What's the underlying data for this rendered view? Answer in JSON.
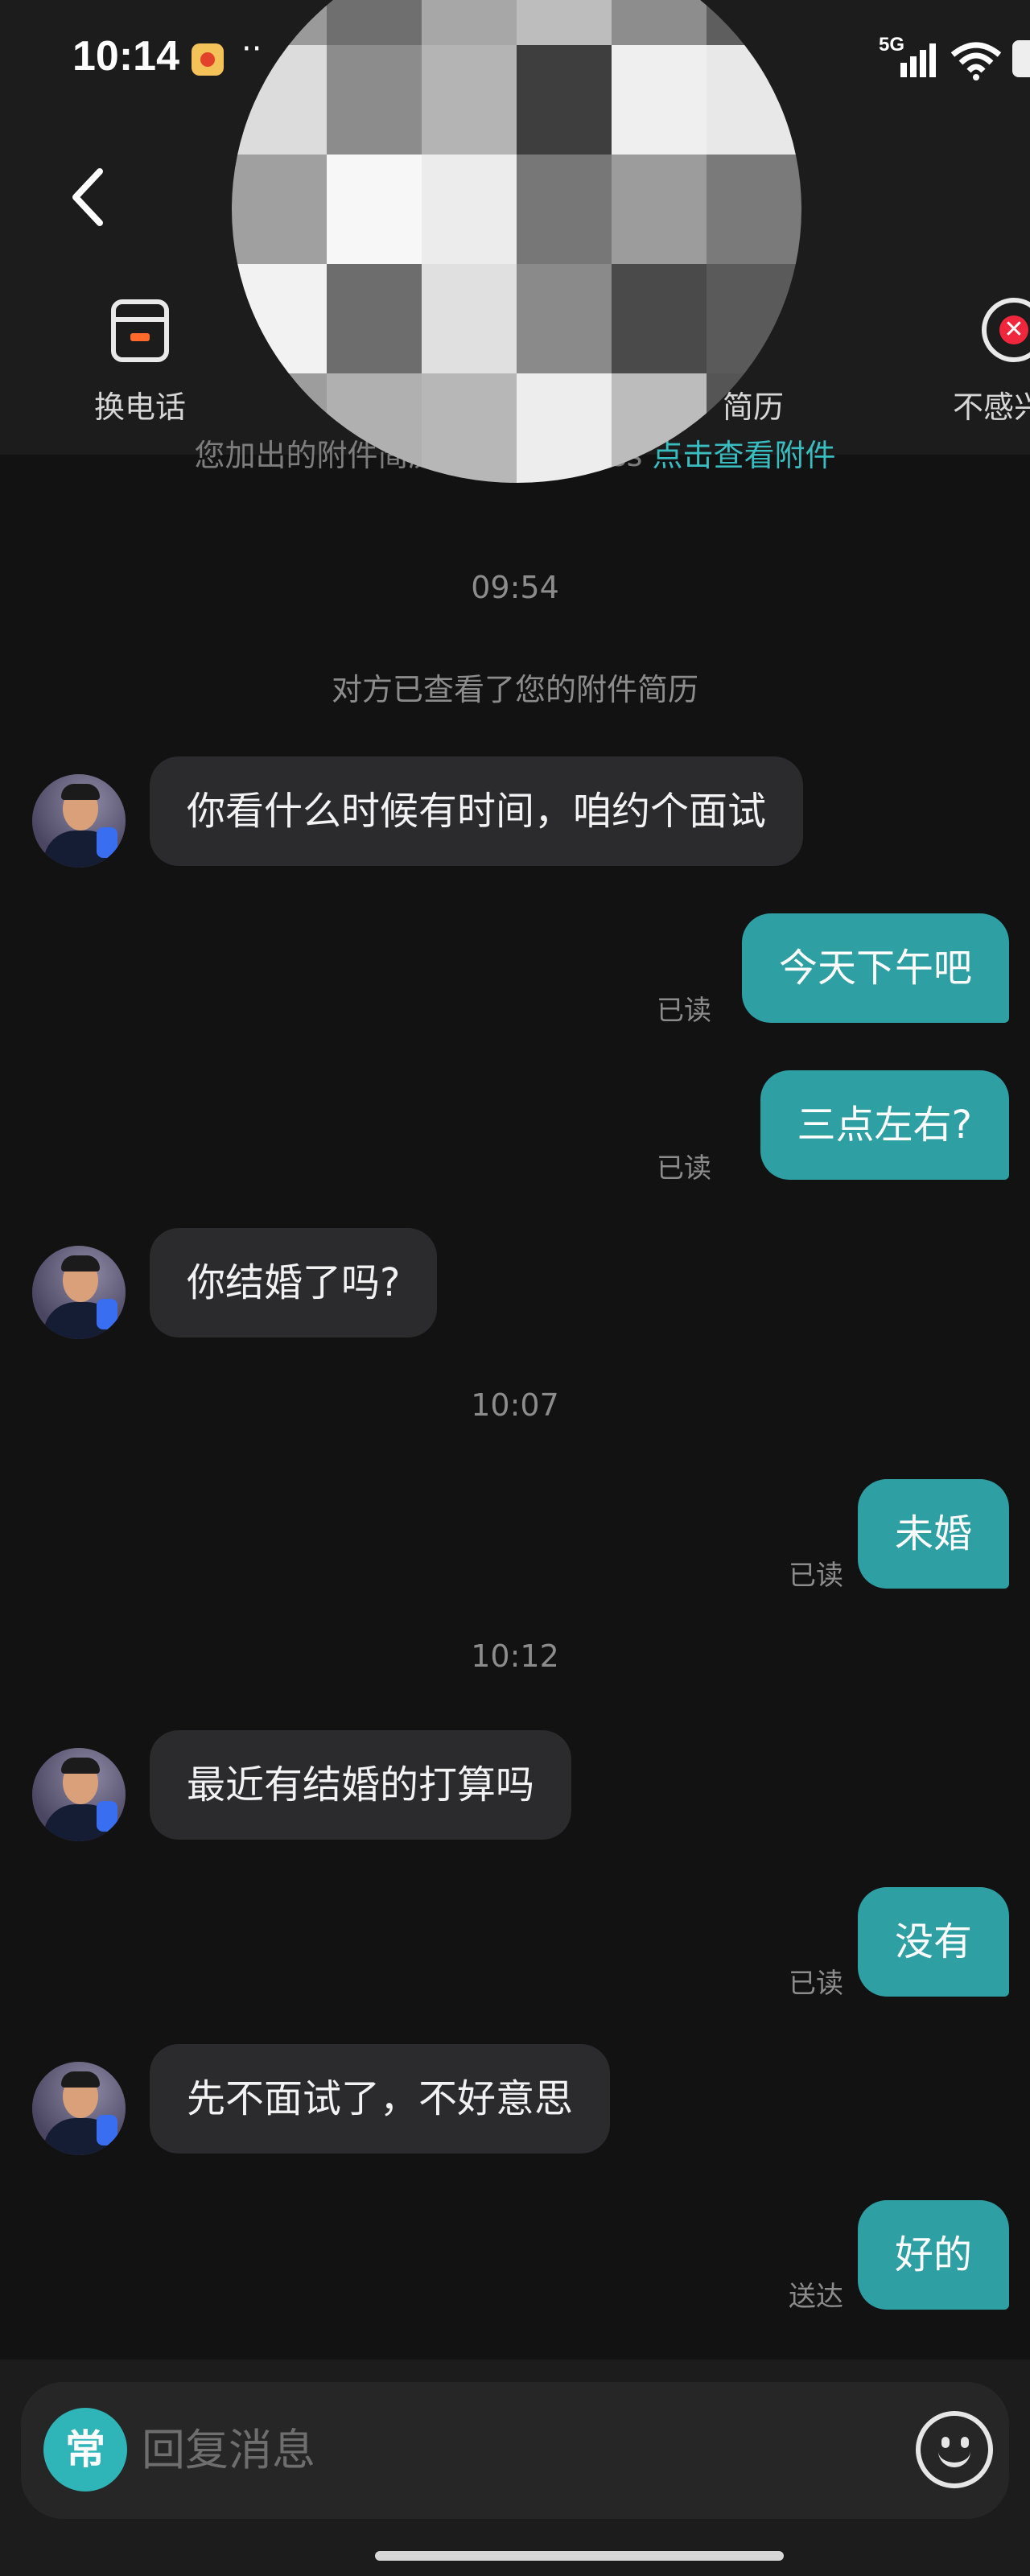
{
  "status_bar": {
    "time": "10:14",
    "dots": "··",
    "network": "5G"
  },
  "actions": [
    {
      "label": "换电话",
      "icon": "phone-swap-icon"
    },
    {
      "label": "简历",
      "icon": "resume-icon"
    },
    {
      "label": "不感兴趣",
      "icon": "not-interested-icon"
    }
  ],
  "system": {
    "banner_text": "您加出的附件简历已发送给 Boss ",
    "banner_link": "点击查看附件",
    "notice": "对方已查看了您的附件简历"
  },
  "times": [
    "09:54",
    "10:07",
    "10:12"
  ],
  "messages": [
    {
      "side": "in",
      "text": "你看什么时候有时间，咱约个面试"
    },
    {
      "side": "out",
      "text": "今天下午吧",
      "status": "已读"
    },
    {
      "side": "out",
      "text": "三点左右?",
      "status": "已读"
    },
    {
      "side": "in",
      "text": "你结婚了吗?"
    },
    {
      "side": "out",
      "text": "未婚",
      "status": "已读"
    },
    {
      "side": "in",
      "text": "最近有结婚的打算吗"
    },
    {
      "side": "out",
      "text": "没有",
      "status": "已读"
    },
    {
      "side": "in",
      "text": "先不面试了，不好意思"
    },
    {
      "side": "out",
      "text": "好的",
      "status": "送达"
    }
  ],
  "input": {
    "common_phrase_label": "常",
    "placeholder": "回复消息"
  },
  "colors": {
    "background": "#121212",
    "header": "#1c1c1c",
    "outgoing_bubble": "#2e9fa3",
    "incoming_bubble": "#2b2b2d",
    "link": "#38bdc0",
    "accent_orange": "#ff6a2c",
    "reject_red": "#f0263d"
  }
}
